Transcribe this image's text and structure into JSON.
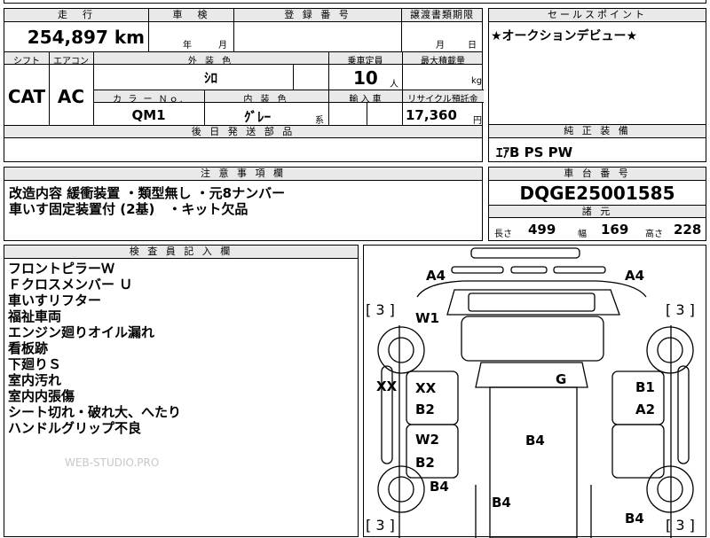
{
  "mileage": {
    "header": "走　行",
    "value": "254,897",
    "unit": "km"
  },
  "inspection": {
    "header": "車　検",
    "year_unit": "年",
    "month_unit": "月"
  },
  "registration": {
    "header": "登 録 番 号"
  },
  "transfer_deadline": {
    "header": "譲渡書類期限",
    "month_unit": "月",
    "day_unit": "日"
  },
  "sales_point": {
    "header": "セールスポイント",
    "text": "★オークションデビュー★"
  },
  "shift": {
    "header": "シフト",
    "value": "CAT"
  },
  "aircon": {
    "header": "エアコン",
    "value": "AC"
  },
  "exterior_color": {
    "header": "外 装 色",
    "value": "ｼﾛ"
  },
  "capacity": {
    "header": "乗車定員",
    "value": "10",
    "unit": "人"
  },
  "max_load": {
    "header": "最大積載量",
    "unit": "kg"
  },
  "color_no": {
    "header": "カ ラ ー Ｎｏ.",
    "value": "QM1"
  },
  "interior_color": {
    "header": "内 装 色",
    "value": "ｸﾞﾚｰ",
    "suffix": "系"
  },
  "import": {
    "header": "輸 入 車"
  },
  "recycle": {
    "header": "リサイクル預託金",
    "value": "17,360",
    "unit": "円"
  },
  "later_parts": {
    "header": "後 日 発 送 部 品"
  },
  "genuine_equipment": {
    "header": "純 正 装 備",
    "value": "ｴｱB  PS  PW"
  },
  "caution": {
    "header": "注 意 事 項 欄",
    "lines": [
      "改造内容 緩衝装置 ・類型無し ・元8ナンバー",
      "車いす固定装置付 (2基)　・キット欠品"
    ]
  },
  "chassis": {
    "header": "車 台 番 号",
    "value": "DQGE25001585"
  },
  "dimensions": {
    "header": "諸 元",
    "length_label": "長さ",
    "length": "499",
    "width_label": "幅",
    "width": "169",
    "height_label": "高さ",
    "height": "228"
  },
  "inspector": {
    "header": "検 査 員 記 入 欄",
    "notes": [
      "フロントピラーＷ",
      "Ｆクロスメンバー Ｕ",
      "車いすリフター",
      "福祉車両",
      "エンジン廻りオイル漏れ",
      "看板跡",
      "下廻りＳ",
      "室内汚れ",
      "室内内張傷",
      "シート切れ・破れ大、へたり",
      "ハンドルグリップ不良"
    ]
  },
  "watermark": "WEB-STUDIO.PRO",
  "damage_map": {
    "labels": [
      "A4",
      "A4",
      "W1",
      "XX",
      "XX",
      "G",
      "B1",
      "B2",
      "A2",
      "W2",
      "B4",
      "B2",
      "B4",
      "B4",
      "B4"
    ],
    "brackets": [
      "[ 3 ]",
      "[ 3 ]",
      "[ 3 ]",
      "[ 3 ]"
    ]
  }
}
